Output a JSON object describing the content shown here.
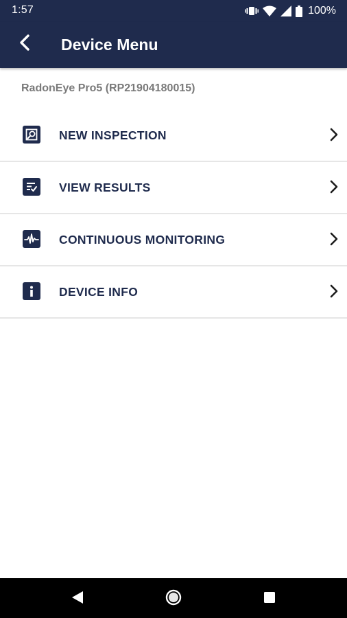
{
  "status_bar": {
    "time": "1:57",
    "battery": "100%",
    "icons": [
      "vibrate-icon",
      "wifi-icon",
      "signal-icon",
      "battery-icon"
    ]
  },
  "app_bar": {
    "title": "Device Menu",
    "back_icon": "chevron-left-icon"
  },
  "device": {
    "name": "RadonEye Pro5 (RP21904180015)"
  },
  "menu": {
    "items": [
      {
        "label": "NEW INSPECTION",
        "icon": "search-document-icon"
      },
      {
        "label": "VIEW RESULTS",
        "icon": "results-list-icon"
      },
      {
        "label": "CONTINUOUS MONITORING",
        "icon": "waveform-icon"
      },
      {
        "label": "DEVICE INFO",
        "icon": "info-icon"
      }
    ]
  },
  "nav_bar": {
    "buttons": [
      "back-triangle-icon",
      "home-circle-icon",
      "recents-square-icon"
    ]
  },
  "colors": {
    "primary": "#1f2b4d",
    "device_name": "#7a7a7a",
    "divider": "#e6e6e6",
    "background": "#ffffff",
    "nav_bar": "#000000"
  }
}
